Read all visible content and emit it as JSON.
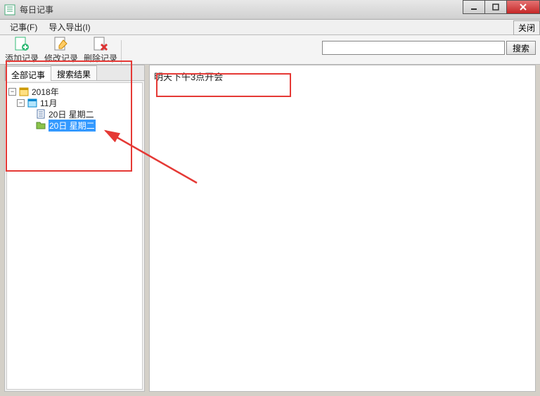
{
  "window": {
    "title": "每日记事"
  },
  "menu": {
    "file": "记事(F)",
    "import_export": "导入导出(I)",
    "close_btn": "关闭"
  },
  "toolbar": {
    "add": "添加记录",
    "edit": "修改记录",
    "delete": "删除记录"
  },
  "search": {
    "placeholder": "",
    "value": "",
    "button": "搜索"
  },
  "tabs": {
    "all": "全部记事",
    "results": "搜索结果"
  },
  "tree": {
    "year": "2018年",
    "month": "11月",
    "entries": [
      {
        "label": "20日 星期二",
        "selected": false
      },
      {
        "label": "20日 星期二",
        "selected": true
      }
    ]
  },
  "note": {
    "body": "明天下午3点开会"
  }
}
